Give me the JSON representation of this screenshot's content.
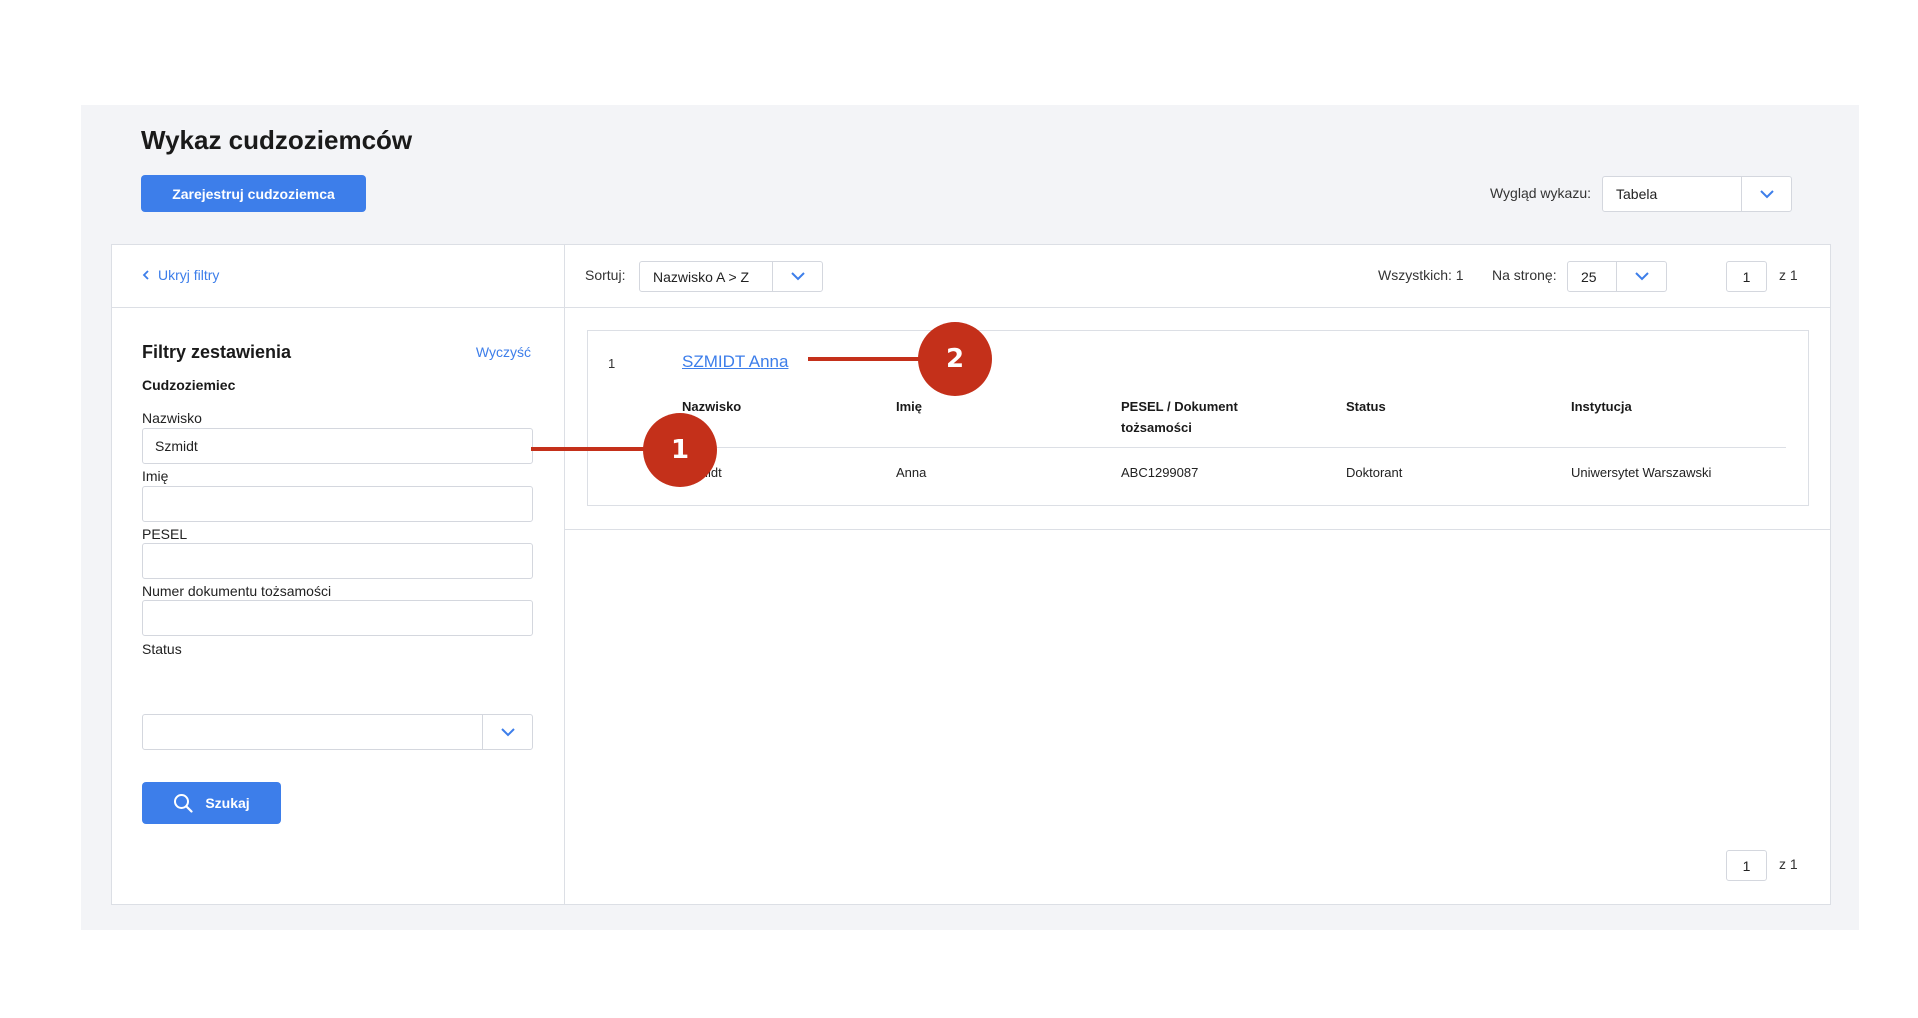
{
  "header": {
    "title": "Wykaz cudzoziemców",
    "register_button": "Zarejestruj cudzoziemca",
    "view_label": "Wygląd wykazu:",
    "view_value": "Tabela"
  },
  "filters": {
    "hide_label": "Ukryj filtry",
    "title": "Filtry zestawienia",
    "clear_label": "Wyczyść",
    "section": "Cudzoziemiec",
    "surname_label": "Nazwisko",
    "surname_value": "Szmidt",
    "name_label": "Imię",
    "name_value": "",
    "pesel_label": "PESEL",
    "pesel_value": "",
    "doc_label": "Numer dokumentu tożsamości",
    "doc_value": "",
    "status_label": "Status",
    "status_value": "",
    "search_button": "Szukaj"
  },
  "toolbar": {
    "sort_label": "Sortuj:",
    "sort_value": "Nazwisko A > Z",
    "total": "Wszystkich: 1",
    "per_page_label": "Na stronę:",
    "per_page_value": "25",
    "page_current": "1",
    "page_of": "z  1"
  },
  "results": [
    {
      "index": "1",
      "title": "SZMIDT Anna",
      "columns": [
        "Nazwisko",
        "Imię",
        "PESEL / Dokument tożsamości",
        "Status",
        "Instytucja"
      ],
      "values": [
        "Szmidt",
        "Anna",
        "ABC1299087",
        "Doktorant",
        "Uniwersytet Warszawski"
      ]
    }
  ],
  "bottom_pager": {
    "page_current": "1",
    "page_of": "z  1"
  },
  "annotations": [
    "1",
    "2"
  ],
  "colors": {
    "accent": "#3d7eea",
    "marker": "#c4301a",
    "background": "#f3f4f7"
  }
}
